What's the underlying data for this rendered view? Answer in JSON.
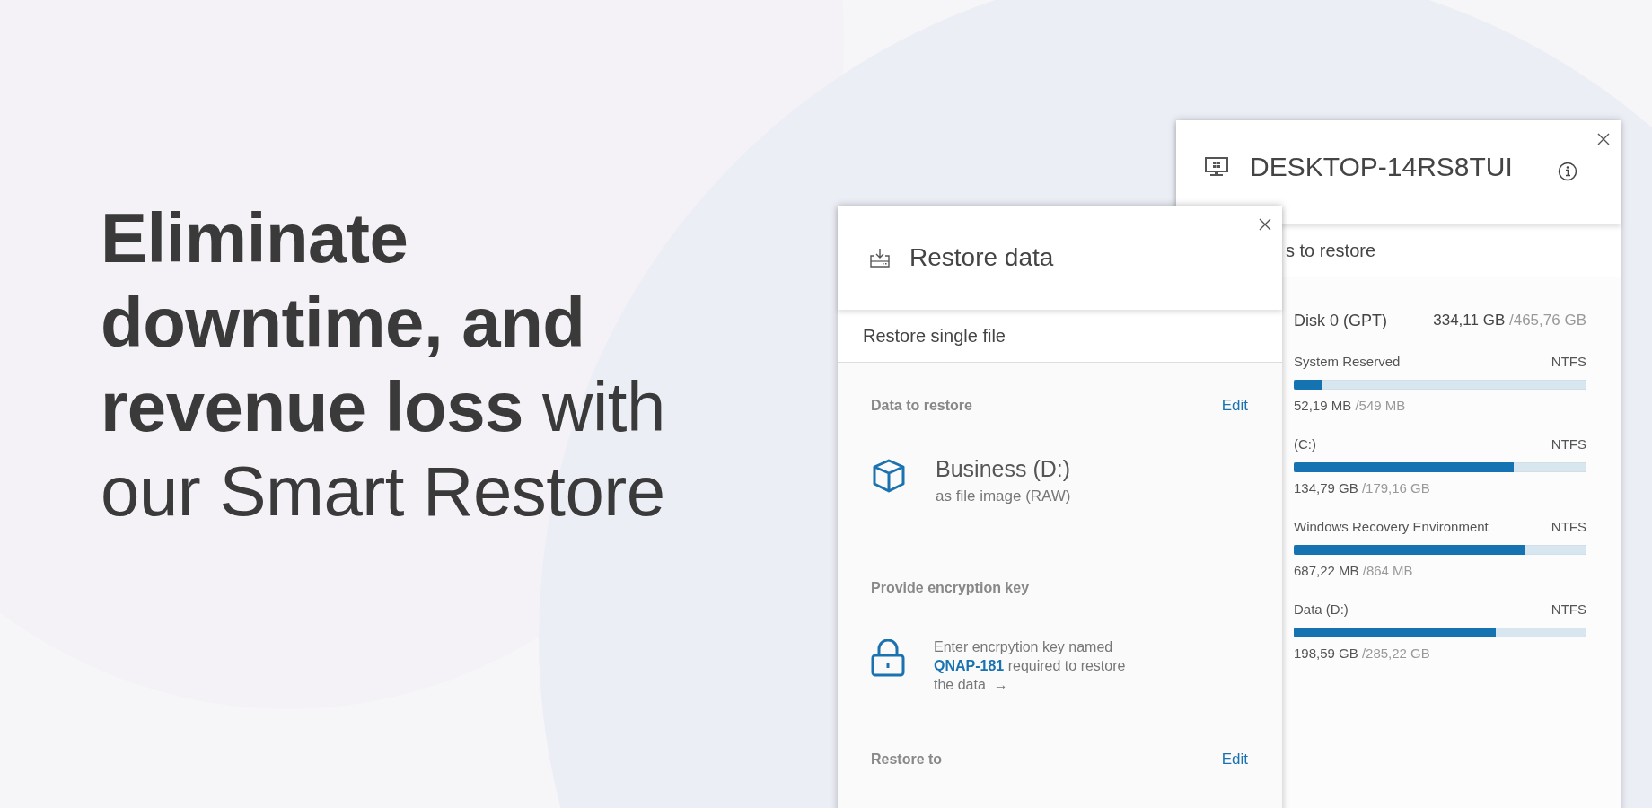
{
  "headline": "**Eliminate downtime, and revenue loss** with our Smart Restore",
  "device_panel": {
    "title": "DESKTOP-14RS8TUI",
    "subtitle": "s to restore",
    "disk": {
      "name": "Disk 0 (GPT)",
      "used": "334,11 GB",
      "total": "/465,76 GB"
    },
    "partitions": [
      {
        "name": "System Reserved",
        "fs": "NTFS",
        "level": 0.095,
        "used": "52,19 MB",
        "total": "/549 MB"
      },
      {
        "name": "(C:)",
        "fs": "NTFS",
        "level": 0.75,
        "used": "134,79 GB",
        "total": "/179,16 GB"
      },
      {
        "name": "Windows Recovery Environment",
        "fs": "NTFS",
        "level": 0.79,
        "used": "687,22 MB",
        "total": "/864 MB"
      },
      {
        "name": "Data (D:)",
        "fs": "NTFS",
        "level": 0.69,
        "used": "198,59 GB",
        "total": "/285,22 GB"
      }
    ]
  },
  "restore_panel": {
    "title": "Restore data",
    "subtitle": "Restore single file",
    "sections": [
      {
        "kind": "item",
        "heading": "Data to restore",
        "action": "Edit",
        "name": "Business (D:)",
        "detail": "as file image (RAW)"
      },
      {
        "kind": "key",
        "heading": "Provide encryption key",
        "text": "Enter encrpytion key named **QNAP-181** required to restore the data  →"
      },
      {
        "kind": "target",
        "heading": "Restore to",
        "action": "Edit"
      }
    ]
  }
}
